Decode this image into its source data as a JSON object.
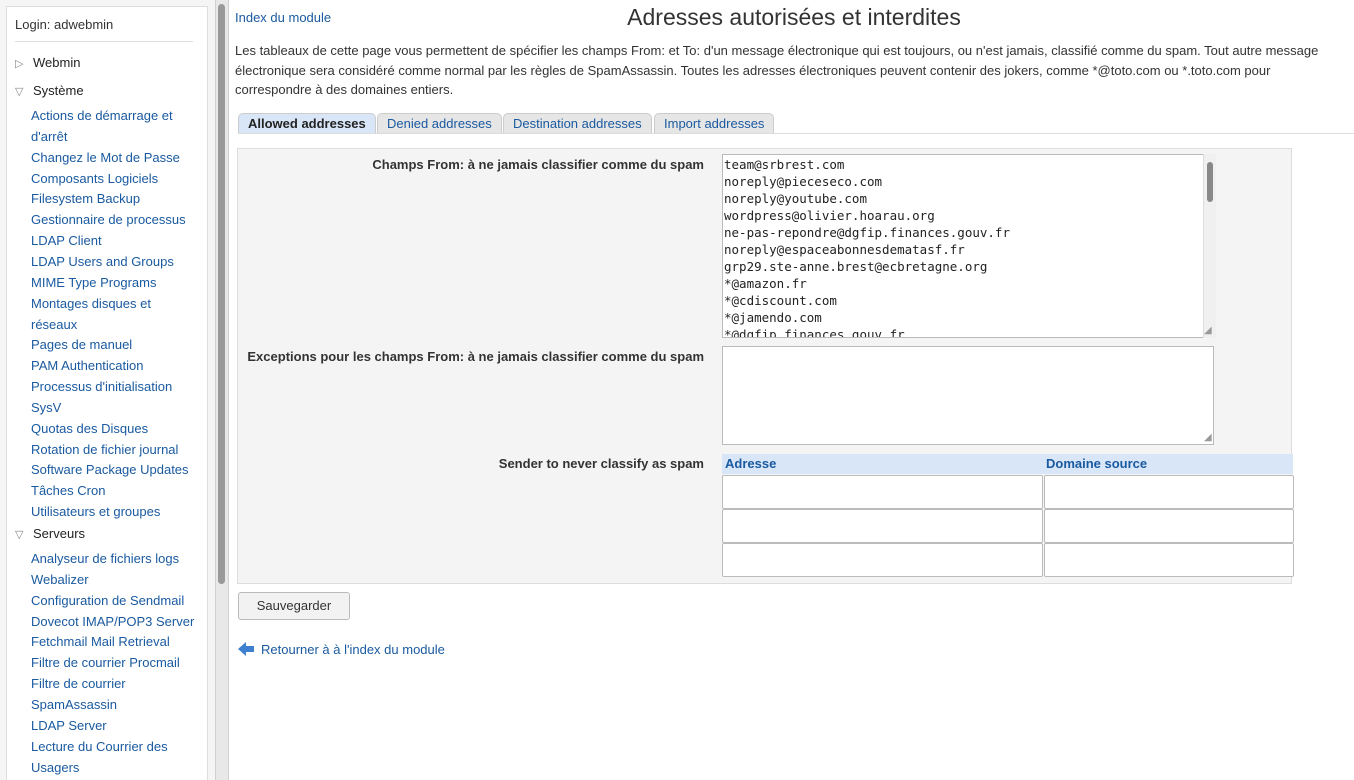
{
  "sidebar": {
    "login": "Login: adwebmin",
    "categories": [
      {
        "label": "Webmin",
        "expanded": false
      },
      {
        "label": "Système",
        "expanded": true
      },
      {
        "label": "Serveurs",
        "expanded": true
      }
    ],
    "system_items": [
      "Actions de démarrage et",
      "d'arrêt",
      "Changez le Mot de Passe",
      "Composants Logiciels",
      "Filesystem Backup",
      "Gestionnaire de processus",
      "LDAP Client",
      "LDAP Users and Groups",
      "MIME Type Programs",
      "Montages disques et",
      "réseaux",
      "Pages de manuel",
      "PAM Authentication",
      "Processus d'initialisation",
      "SysV",
      "Quotas des Disques",
      "Rotation de fichier journal",
      "Software Package Updates",
      "Tâches Cron",
      "Utilisateurs et groupes"
    ],
    "server_items": [
      "Analyseur de fichiers logs",
      "Webalizer",
      "Configuration de Sendmail",
      "Dovecot IMAP/POP3 Server",
      "Fetchmail Mail Retrieval",
      "Filtre de courrier Procmail",
      "Filtre de courrier",
      "SpamAssassin",
      "LDAP Server",
      "Lecture du Courrier des",
      "Usagers"
    ]
  },
  "header": {
    "module_index": "Index du module",
    "title": "Adresses autorisées et interdites"
  },
  "intro": "Les tableaux de cette page vous permettent de spécifier les champs From: et To: d'un message électronique qui est toujours, ou n'est jamais, classifié comme du spam. Tout autre message électronique sera considéré comme normal par les règles de SpamAssassin. Toutes les adresses électroniques peuvent contenir des jokers, comme *@toto.com ou *.toto.com pour correspondre à des domaines entiers.",
  "tabs": [
    {
      "label": "Allowed addresses",
      "active": true
    },
    {
      "label": "Denied addresses",
      "active": false
    },
    {
      "label": "Destination addresses",
      "active": false
    },
    {
      "label": "Import addresses",
      "active": false
    }
  ],
  "form": {
    "from_label": "Champs From: à ne jamais classifier comme du spam",
    "from_value": "team@srbrest.com\nnoreply@pieceseco.com\nnoreply@youtube.com\nwordpress@olivier.hoarau.org\nne-pas-repondre@dgfip.finances.gouv.fr\nnoreply@espaceabonnesdematasf.fr\ngrp29.ste-anne.brest@ecbretagne.org\n*@amazon.fr\n*@cdiscount.com\n*@jamendo.com\n*@dgfip.finances.gouv.fr",
    "exceptions_label": "Exceptions pour les champs From: à ne jamais classifier comme du spam",
    "exceptions_value": "",
    "sender_label": "Sender to never classify as spam",
    "col_address": "Adresse",
    "col_domain": "Domaine source"
  },
  "save_label": "Sauvegarder",
  "back_label": "Retourner à à l'index du module"
}
